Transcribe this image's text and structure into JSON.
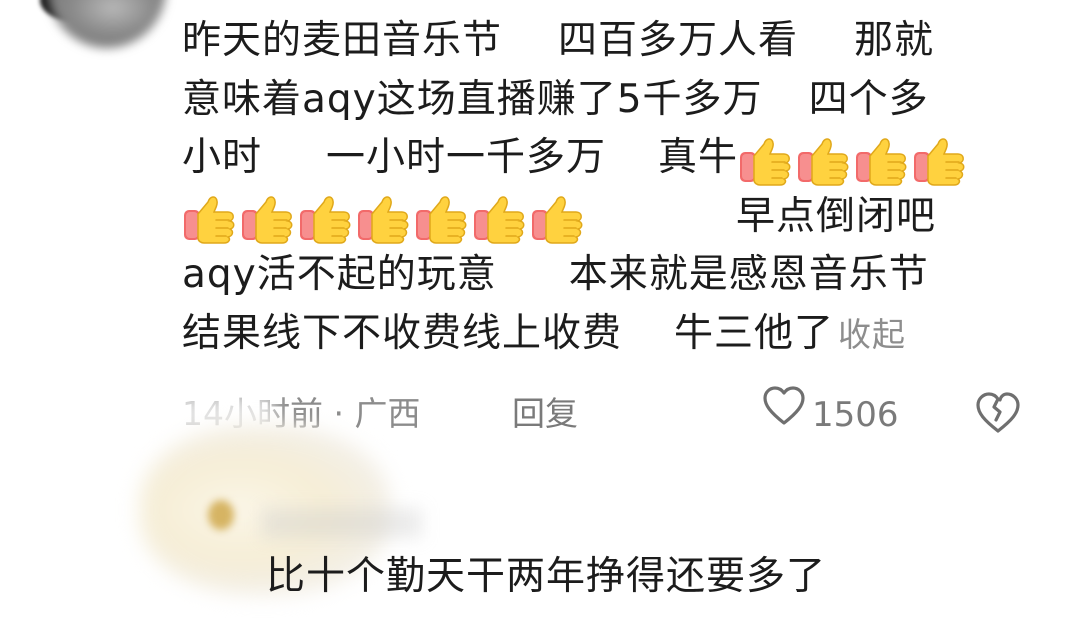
{
  "comment": {
    "lines": [
      {
        "segments": [
          "昨天的麦田音乐节",
          "四百多万人看",
          "那就"
        ]
      },
      {
        "segments": [
          "意味着aqy这场直播赚了5千多万",
          "四个多"
        ]
      },
      {
        "segments": [
          "小时",
          "一小时一千多万",
          "真牛"
        ]
      },
      {
        "segments": [
          "早点倒闭吧"
        ]
      },
      {
        "segments": [
          "aqy活不起的玩意",
          "本来就是感恩音乐节"
        ]
      },
      {
        "segments": [
          "结果线下不收费线上收费",
          "牛三他了"
        ]
      }
    ],
    "emoji": {
      "name": "thumbs-up-icon",
      "count_line3": 4,
      "count_line4": 7
    },
    "collapse_label": "收起"
  },
  "meta": {
    "time_location": "14小时前 · 广西",
    "reply_label": "回复",
    "like_count": "1506"
  },
  "reply": {
    "text": "比十个勤天干两年挣得还要多了"
  },
  "colors": {
    "text": "#1c1c1c",
    "meta": "#8c8c8c",
    "thumb_yellow": "#ffd23f",
    "sleeve_red": "#f26a6a"
  }
}
